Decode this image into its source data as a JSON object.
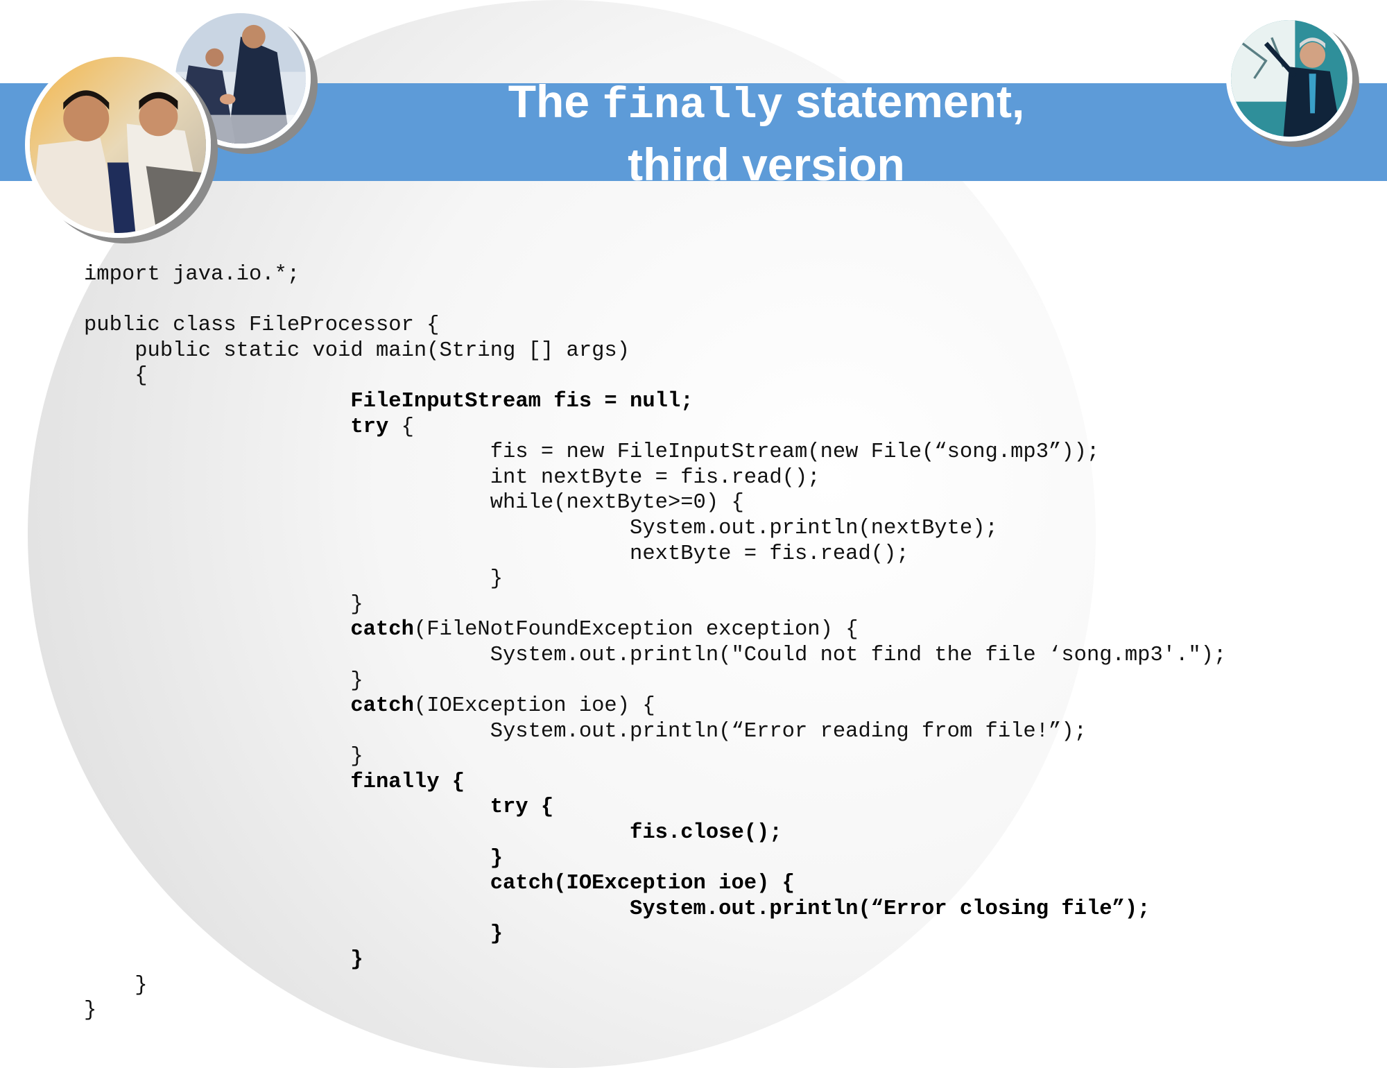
{
  "slide": {
    "title_part1": "The ",
    "title_keyword": "finally",
    "title_part2": " statement,",
    "title_line2": "third version"
  },
  "images": {
    "left_large": "two-businessmen-at-laptop-photo",
    "left_small": "handshake-photo",
    "right": "presenter-at-whiteboard-photo"
  },
  "colors": {
    "title_bar": "#5d9bd8",
    "title_text": "#ffffff"
  },
  "code_lines": [
    {
      "indent": "",
      "segments": [
        {
          "t": "import java.io.*;",
          "b": false
        }
      ]
    },
    {
      "indent": "",
      "segments": []
    },
    {
      "indent": "",
      "segments": [
        {
          "t": "public class FileProcessor {",
          "b": false
        }
      ]
    },
    {
      "indent": "    ",
      "segments": [
        {
          "t": "public static void main(String [] args)",
          "b": false
        }
      ]
    },
    {
      "indent": "    ",
      "segments": [
        {
          "t": "{",
          "b": false
        }
      ]
    },
    {
      "indent": "                     ",
      "segments": [
        {
          "t": "FileInputStream fis = null;",
          "b": true
        }
      ]
    },
    {
      "indent": "                     ",
      "segments": [
        {
          "t": "try",
          "b": true
        },
        {
          "t": " {",
          "b": false
        }
      ]
    },
    {
      "indent": "                                ",
      "segments": [
        {
          "t": "fis = new FileInputStream(new File(“song.mp3”));",
          "b": false
        }
      ]
    },
    {
      "indent": "                                ",
      "segments": [
        {
          "t": "int nextByte = fis.read();",
          "b": false
        }
      ]
    },
    {
      "indent": "                                ",
      "segments": [
        {
          "t": "while(nextByte>=0) {",
          "b": false
        }
      ]
    },
    {
      "indent": "                                           ",
      "segments": [
        {
          "t": "System.out.println(nextByte);",
          "b": false
        }
      ]
    },
    {
      "indent": "                                           ",
      "segments": [
        {
          "t": "nextByte = fis.read();",
          "b": false
        }
      ]
    },
    {
      "indent": "                                ",
      "segments": [
        {
          "t": "}",
          "b": false
        }
      ]
    },
    {
      "indent": "                     ",
      "segments": [
        {
          "t": "}",
          "b": false
        }
      ]
    },
    {
      "indent": "                     ",
      "segments": [
        {
          "t": "catch",
          "b": true
        },
        {
          "t": "(FileNotFoundException exception) {",
          "b": false
        }
      ]
    },
    {
      "indent": "                                ",
      "segments": [
        {
          "t": "System.out.println(\"Could not find the file ‘song.mp3'.\");",
          "b": false
        }
      ]
    },
    {
      "indent": "                     ",
      "segments": [
        {
          "t": "}",
          "b": false
        }
      ]
    },
    {
      "indent": "                     ",
      "segments": [
        {
          "t": "catch",
          "b": true
        },
        {
          "t": "(IOException ioe) {",
          "b": false
        }
      ]
    },
    {
      "indent": "                                ",
      "segments": [
        {
          "t": "System.out.println(“Error reading from file!”);",
          "b": false
        }
      ]
    },
    {
      "indent": "                     ",
      "segments": [
        {
          "t": "}",
          "b": false
        }
      ]
    },
    {
      "indent": "                     ",
      "segments": [
        {
          "t": "finally {",
          "b": true
        }
      ]
    },
    {
      "indent": "                                ",
      "segments": [
        {
          "t": "try {",
          "b": true
        }
      ]
    },
    {
      "indent": "                                           ",
      "segments": [
        {
          "t": "fis.close();",
          "b": true
        }
      ]
    },
    {
      "indent": "                                ",
      "segments": [
        {
          "t": "}",
          "b": true
        }
      ]
    },
    {
      "indent": "                                ",
      "segments": [
        {
          "t": "catch(IOException ioe) {",
          "b": true
        }
      ]
    },
    {
      "indent": "                                           ",
      "segments": [
        {
          "t": "System.out.println(“Error closing file”);",
          "b": true
        }
      ]
    },
    {
      "indent": "                                ",
      "segments": [
        {
          "t": "}",
          "b": true
        }
      ]
    },
    {
      "indent": "                     ",
      "segments": [
        {
          "t": "}",
          "b": true
        }
      ]
    },
    {
      "indent": "    ",
      "segments": [
        {
          "t": "}",
          "b": false
        }
      ]
    },
    {
      "indent": "",
      "segments": [
        {
          "t": "}",
          "b": false
        }
      ]
    }
  ]
}
